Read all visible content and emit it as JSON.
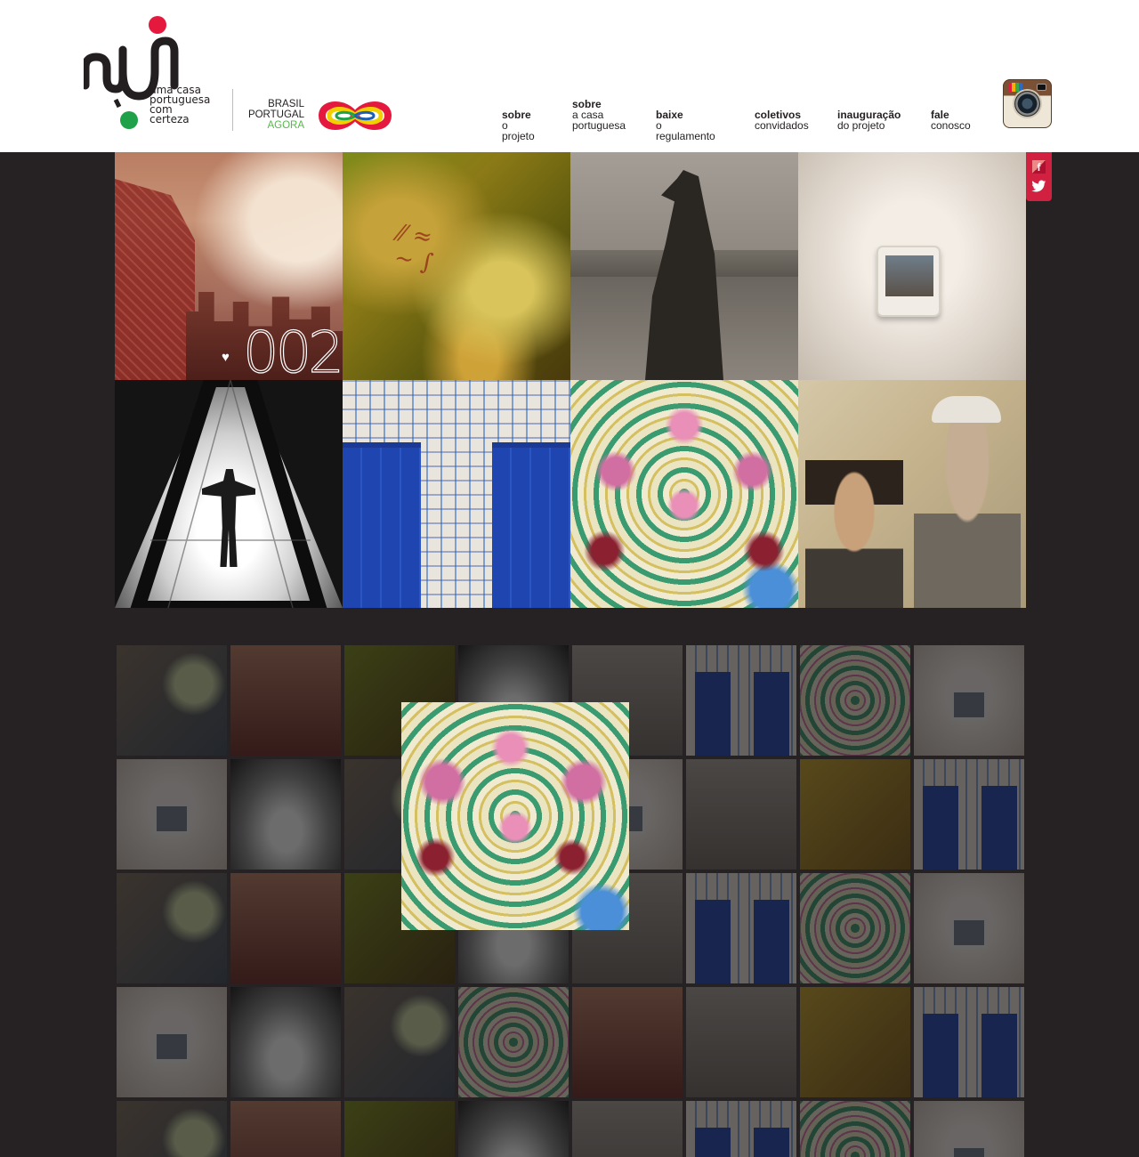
{
  "brand": {
    "logo_lines": [
      "uma casa",
      "portuguesa",
      "com",
      "certeza"
    ],
    "partner_lines": [
      "BRASIL",
      "PORTUGAL",
      "AGORA"
    ],
    "colors": {
      "red": "#e4193d",
      "green": "#1fa149",
      "dark": "#231f20",
      "agora_green": "#54b948"
    }
  },
  "nav": [
    {
      "bold": "sobre",
      "normal": "o projeto"
    },
    {
      "bold": "sobre",
      "normal": "a casa portuguesa"
    },
    {
      "bold": "baixe",
      "normal": "o regulamento"
    },
    {
      "bold": "coletivos",
      "normal": "convidados"
    },
    {
      "bold": "inauguração",
      "normal": "do projeto"
    },
    {
      "bold": "fale",
      "normal": "conosco"
    }
  ],
  "social": {
    "icons": [
      "instagram-icon",
      "facebook-icon",
      "twitter-icon"
    ],
    "facebook_glyph": "f"
  },
  "gallery": {
    "counter": "002",
    "tiles": [
      "city",
      "wall-graffiti",
      "woman-beach",
      "photo-frame",
      "triangle-silhouette",
      "blue-doors",
      "floral-fabric",
      "old-portrait"
    ]
  },
  "mosaic": {
    "featured": "floral-fabric"
  }
}
